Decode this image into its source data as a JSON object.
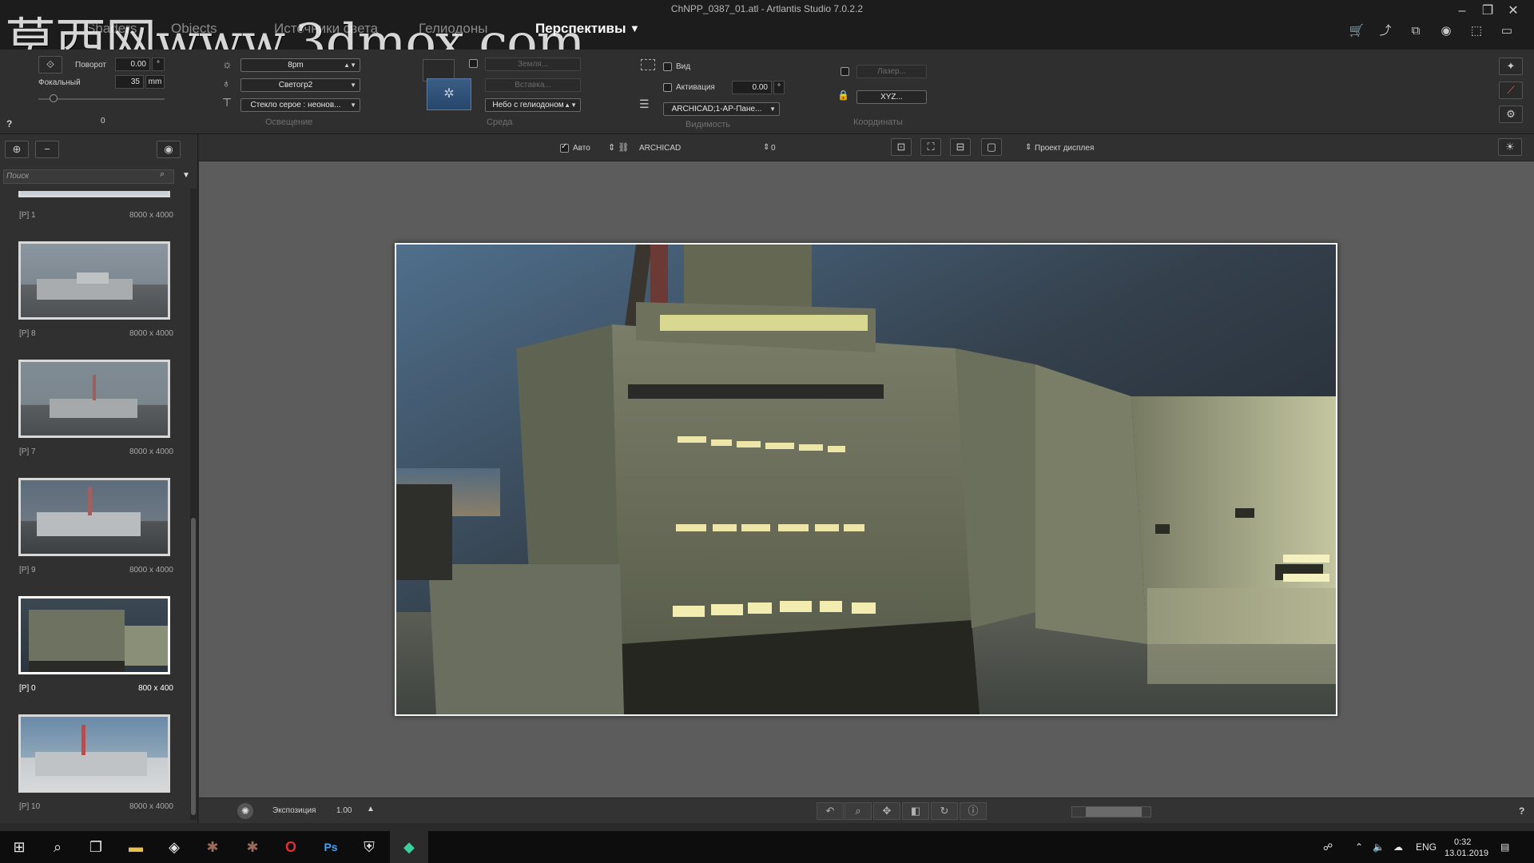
{
  "window": {
    "title": "ChNPP_0387_01.atl - Artlantis Studio 7.0.2.2",
    "watermark": "莫西网www.3dmox.com"
  },
  "menu": [
    {
      "label": "Shaders"
    },
    {
      "label": "Objects"
    },
    {
      "label": "Источники света"
    },
    {
      "label": "Гелиодоны"
    },
    {
      "label": "Перспективы",
      "active": true
    }
  ],
  "camera": {
    "rotation_label": "Поворот",
    "rotation_value": "0.00",
    "rotation_unit": "°",
    "focal_label": "Фокальный",
    "focal_value": "35",
    "focal_unit": "mm",
    "help": "?",
    "roll_value": "0"
  },
  "lighting": {
    "time": "8pm",
    "light_group": "Светогр2",
    "material": "Стекло серое : неонов...",
    "section_label": "Освещение"
  },
  "environment": {
    "ground_btn": "Земля...",
    "insert_btn": "Вставка...",
    "sky": "Небо с гелиодоном",
    "section_label": "Среда"
  },
  "visibility": {
    "view_label": "Вид",
    "activation_label": "Активация",
    "activation_value": "0.00",
    "activation_unit": "°",
    "layer": "ARCHICAD;1-АР-Пане...",
    "section_label": "Видимость"
  },
  "coordinates": {
    "laser_btn": "Лазер...",
    "xyz_btn": "XYZ...",
    "section_label": "Координаты"
  },
  "viewbar": {
    "auto_label": "Авто",
    "source": "ARCHICAD",
    "value": "0",
    "display_project": "Проект дисплея"
  },
  "left_panel": {
    "search_placeholder": "Поиск",
    "thumbnails": [
      {
        "name": "[P] 1",
        "size": "8000 x 4000",
        "partial": true
      },
      {
        "name": "[P] 8",
        "size": "8000 x 4000"
      },
      {
        "name": "[P] 7",
        "size": "8000 x 4000"
      },
      {
        "name": "[P] 9",
        "size": "8000 x 4000"
      },
      {
        "name": "[P] 0",
        "size": "800 x 400",
        "selected": true
      },
      {
        "name": "[P] 10",
        "size": "8000 x 4000"
      }
    ]
  },
  "bottombar": {
    "exposure_label": "Экспозиция",
    "exposure_value": "1.00",
    "help": "?"
  },
  "taskbar": {
    "lang": "ENG",
    "time": "0:32",
    "date": "13.01.2019"
  },
  "colors": {
    "accent_selected": "#ffffff",
    "sky_top": "#2f3a44",
    "building": "#7d8468"
  }
}
